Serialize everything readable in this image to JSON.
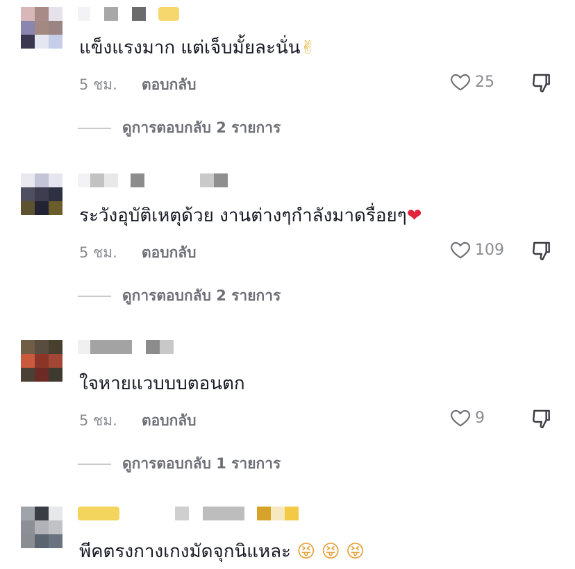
{
  "comments": [
    {
      "text": "แข็งแรงมาก แต่เจ็บมั้ยละนั่น",
      "emoji": "✌",
      "time": "5 ชม.",
      "reply_label": "ตอบกลับ",
      "likes": "25",
      "view_replies": "ดูการตอบกลับ 2 รายการ"
    },
    {
      "text": "ระวังอุบัติเหตุด้วย งานต่างๆกำลังมาดรื่อยๆ",
      "emoji": "❤",
      "time": "5 ชม.",
      "reply_label": "ตอบกลับ",
      "likes": "109",
      "view_replies": "ดูการตอบกลับ 2 รายการ"
    },
    {
      "text": "ใจหายแวบบบตอนตก",
      "emoji": "",
      "time": "5 ชม.",
      "reply_label": "ตอบกลับ",
      "likes": "9",
      "view_replies": "ดูการตอบกลับ 1 รายการ"
    },
    {
      "text": "พีคตรงกางเกงมัดจุกนิแหละ",
      "emoji": "😝 😝 😝",
      "time": "",
      "reply_label": "",
      "likes": "",
      "view_replies": ""
    }
  ],
  "colors": {
    "heart": "#e0243b",
    "meta": "#8a8b91",
    "text": "#161823"
  }
}
